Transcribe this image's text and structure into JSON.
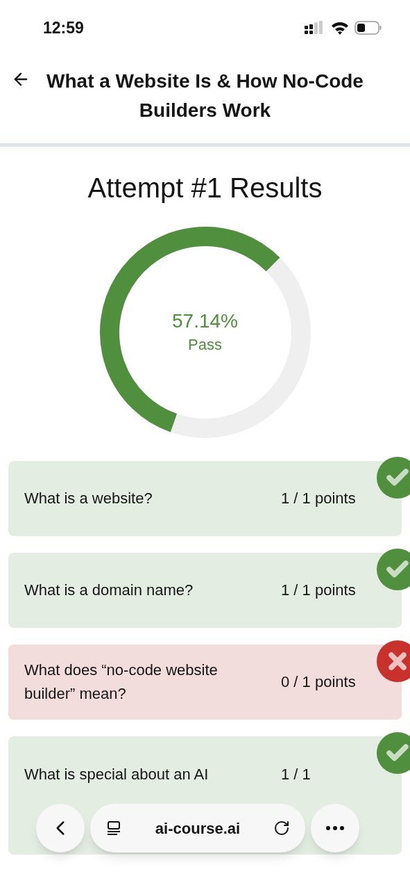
{
  "status_bar": {
    "time": "12:59"
  },
  "header": {
    "title": "What a Website Is & How No-Code Builders Work"
  },
  "results": {
    "title": "Attempt #1 Results",
    "score": {
      "percent": "57.14%",
      "label": "Pass"
    }
  },
  "questions": [
    {
      "question": "What is a website?",
      "points": "1 / 1 points",
      "correct": true
    },
    {
      "question": "What is a domain name?",
      "points": "1 / 1 points",
      "correct": true
    },
    {
      "question": "What does “no-code website builder” mean?",
      "points": "0 / 1 points",
      "correct": false
    },
    {
      "question": "What is special about an AI",
      "points": "1 / 1",
      "correct": true
    }
  ],
  "browser_bar": {
    "url": "ai-course.ai"
  }
}
